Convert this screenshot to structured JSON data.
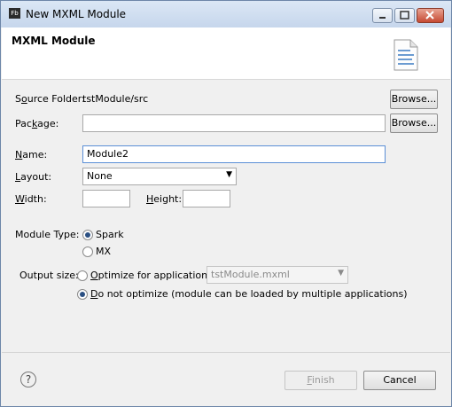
{
  "window": {
    "title": "New MXML Module",
    "app_icon_text": "Fb"
  },
  "header": {
    "title": "MXML Module",
    "icon": "document-icon"
  },
  "form": {
    "source_folder": {
      "label": "Source Folder:",
      "value": "tstModule/src",
      "browse": "Browse..."
    },
    "package": {
      "label": "Package:",
      "value": "",
      "browse": "Browse..."
    },
    "name": {
      "label": "Name:",
      "value": "Module2"
    },
    "layout": {
      "label": "Layout:",
      "selected": "None"
    },
    "width": {
      "label": "Width:",
      "value": ""
    },
    "height": {
      "label": "Height:",
      "value": ""
    },
    "module_type": {
      "label": "Module Type:",
      "options": [
        "Spark",
        "MX"
      ],
      "selected": "Spark"
    },
    "output_size": {
      "label": "Output size:",
      "optimize_label": "Optimize for application:",
      "optimize_app": "tstModule.mxml",
      "no_optimize_label": "Do not optimize (module can be loaded by multiple applications)",
      "selected": "Do not optimize"
    }
  },
  "footer": {
    "finish": "Finish",
    "cancel": "Cancel",
    "help_icon": "help-icon"
  }
}
